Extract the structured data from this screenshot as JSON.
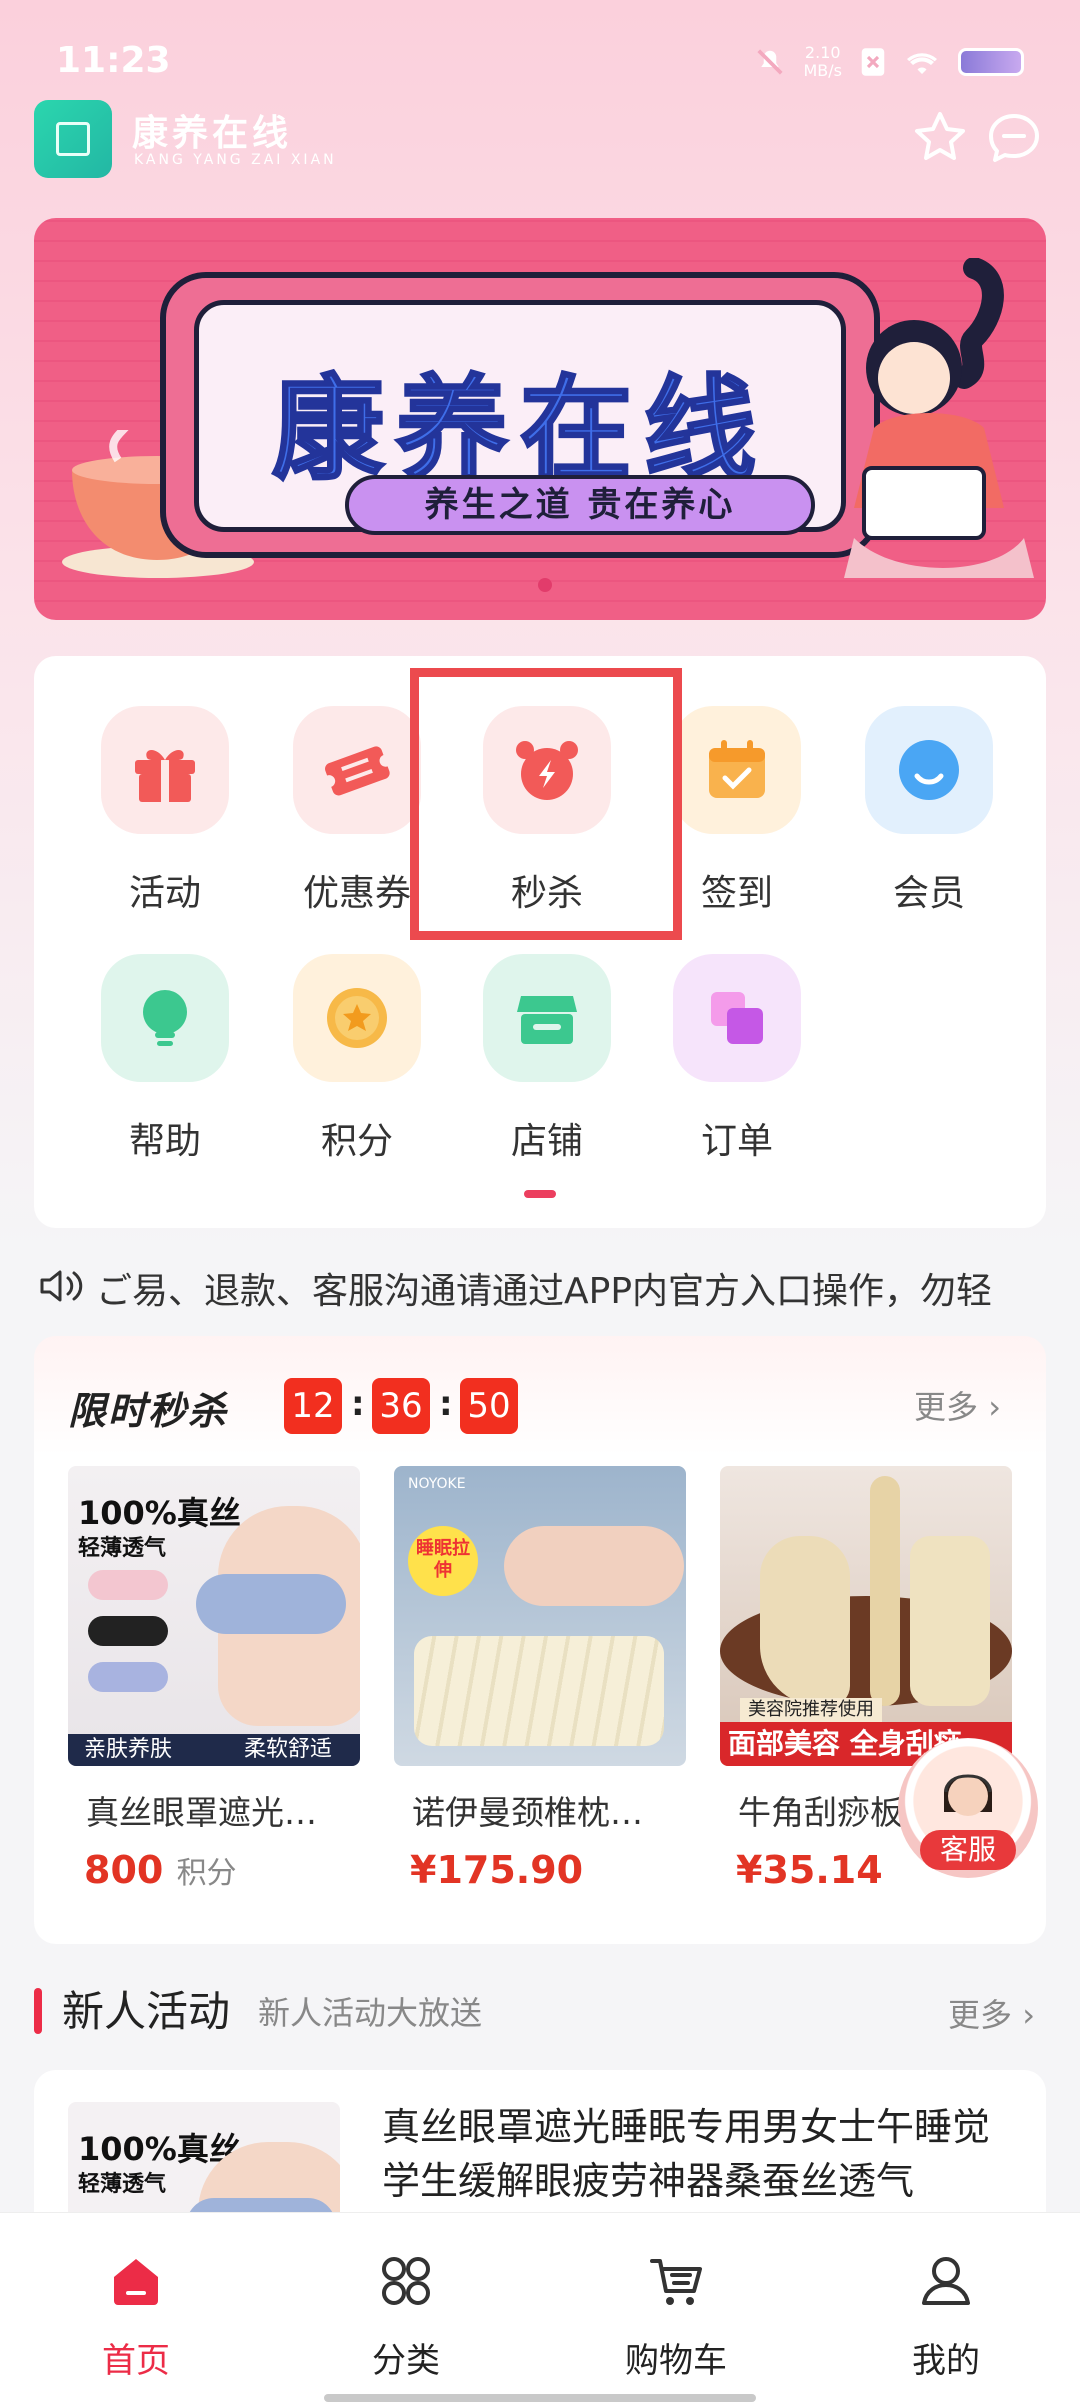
{
  "status": {
    "time": "11:23",
    "net_speed_top": "2.10",
    "net_speed_unit": "MB/s"
  },
  "header": {
    "title": "康养在线",
    "subtitle": "KANG YANG ZAI XIAN"
  },
  "banner": {
    "title": "康养在线",
    "slogan": "养生之道  贵在养心"
  },
  "grid": {
    "items": [
      {
        "label": "活动"
      },
      {
        "label": "优惠券"
      },
      {
        "label": "秒杀"
      },
      {
        "label": "签到"
      },
      {
        "label": "会员"
      },
      {
        "label": "帮助"
      },
      {
        "label": "积分"
      },
      {
        "label": "店铺"
      },
      {
        "label": "订单"
      }
    ]
  },
  "notice": {
    "text": "ご易、退款、客服沟通请通过APP内官方入口操作，勿轻"
  },
  "flash_sale": {
    "title": "限时秒杀",
    "timer": {
      "h": "12",
      "m": "36",
      "s": "50"
    },
    "more": "更多",
    "products": [
      {
        "name": "真丝眼罩遮光…",
        "price": "800",
        "unit": "积分",
        "img_top": "100%真丝",
        "img_sub": "轻薄透气",
        "img_band_left": "亲肤养肤",
        "img_band_right": "柔软舒适"
      },
      {
        "name": "诺伊曼颈椎枕…",
        "price": "¥175.90",
        "unit": "",
        "img_top": "NOYOKE",
        "img_sub": "睡眠拉伸"
      },
      {
        "name": "牛角刮痧板…",
        "price": "¥35.14",
        "unit": "",
        "img_top": "美容院推荐使用",
        "img_sub": "面部美容 全身刮痧"
      }
    ]
  },
  "customer_service": {
    "label": "客服"
  },
  "new_user": {
    "title": "新人活动",
    "subtitle": "新人活动大放送",
    "more": "更多",
    "item": {
      "desc": "真丝眼罩遮光睡眠专用男女士午睡觉学生缓解眼疲劳神器桑蚕丝透气",
      "img_top": "100%真丝",
      "img_sub": "轻薄透气"
    }
  },
  "tabs": [
    {
      "label": "首页",
      "active": true
    },
    {
      "label": "分类",
      "active": false
    },
    {
      "label": "购物车",
      "active": false
    },
    {
      "label": "我的",
      "active": false
    }
  ],
  "colors": {
    "accent": "#ec2c47",
    "price": "#e23424",
    "highlight": "#ec4a4e"
  }
}
